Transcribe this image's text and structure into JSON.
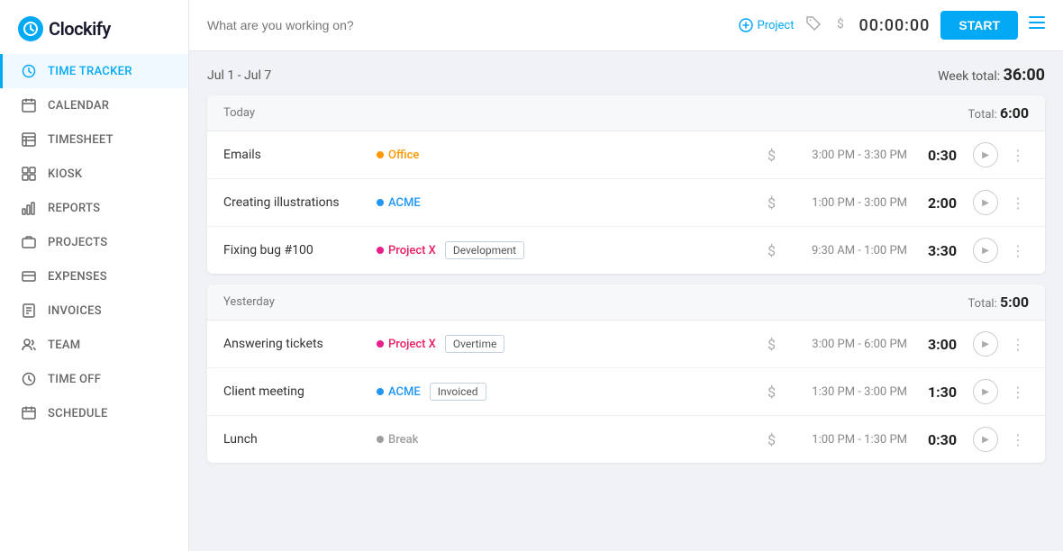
{
  "app": {
    "name": "Clockify",
    "logo_letter": "C"
  },
  "sidebar": {
    "items": [
      {
        "id": "time-tracker",
        "label": "TIME TRACKER",
        "icon": "clock",
        "active": true
      },
      {
        "id": "calendar",
        "label": "CALENDAR",
        "icon": "calendar"
      },
      {
        "id": "timesheet",
        "label": "TIMESHEET",
        "icon": "timesheet"
      },
      {
        "id": "kiosk",
        "label": "KIOSK",
        "icon": "kiosk"
      },
      {
        "id": "reports",
        "label": "REPORTS",
        "icon": "bar-chart"
      },
      {
        "id": "projects",
        "label": "PROJECTS",
        "icon": "projects"
      },
      {
        "id": "expenses",
        "label": "EXPENSES",
        "icon": "expenses"
      },
      {
        "id": "invoices",
        "label": "INVOICES",
        "icon": "invoices"
      },
      {
        "id": "team",
        "label": "TEAM",
        "icon": "team"
      },
      {
        "id": "time-off",
        "label": "TIME OFF",
        "icon": "time-off"
      },
      {
        "id": "schedule",
        "label": "SCHEDULE",
        "icon": "schedule"
      }
    ]
  },
  "topbar": {
    "search_placeholder": "What are you working on?",
    "project_label": "Project",
    "time_display": "00:00:00",
    "start_label": "START"
  },
  "content": {
    "week_range": "Jul 1 - Jul 7",
    "week_total_label": "Week total:",
    "week_total_value": "36:00",
    "day_groups": [
      {
        "label": "Today",
        "total_label": "Total:",
        "total_value": "6:00",
        "entries": [
          {
            "name": "Emails",
            "project": "Office",
            "project_color": "orange",
            "badge": null,
            "time_range": "3:00 PM - 3:30 PM",
            "duration": "0:30"
          },
          {
            "name": "Creating illustrations",
            "project": "ACME",
            "project_color": "blue",
            "badge": null,
            "time_range": "1:00 PM - 3:00 PM",
            "duration": "2:00"
          },
          {
            "name": "Fixing bug #100",
            "project": "Project X",
            "project_color": "pink",
            "badge": "Development",
            "time_range": "9:30 AM - 1:00 PM",
            "duration": "3:30"
          }
        ]
      },
      {
        "label": "Yesterday",
        "total_label": "Total:",
        "total_value": "5:00",
        "entries": [
          {
            "name": "Answering tickets",
            "project": "Project X",
            "project_color": "pink",
            "badge": "Overtime",
            "time_range": "3:00 PM - 6:00 PM",
            "duration": "3:00"
          },
          {
            "name": "Client meeting",
            "project": "ACME",
            "project_color": "blue",
            "badge": "Invoiced",
            "time_range": "1:30 PM - 3:00 PM",
            "duration": "1:30"
          },
          {
            "name": "Lunch",
            "project": "Break",
            "project_color": "gray",
            "badge": null,
            "time_range": "1:00 PM - 1:30 PM",
            "duration": "0:30"
          }
        ]
      }
    ]
  }
}
